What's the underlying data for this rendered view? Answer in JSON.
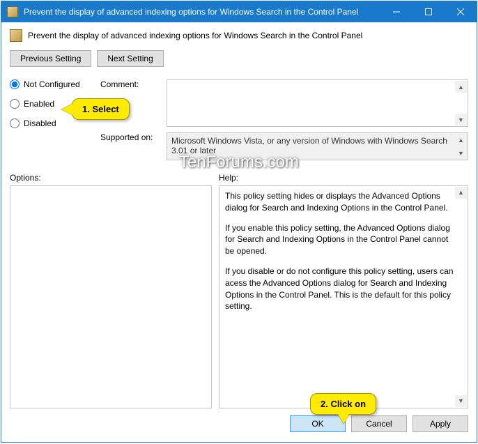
{
  "titlebar": {
    "title": "Prevent the display of advanced indexing options for Windows Search in the Control Panel"
  },
  "header": {
    "policy_title": "Prevent the display of advanced indexing options for Windows Search in the Control Panel"
  },
  "nav": {
    "previous": "Previous Setting",
    "next": "Next Setting"
  },
  "radios": {
    "not_configured": "Not Configured",
    "enabled": "Enabled",
    "disabled": "Disabled"
  },
  "fields": {
    "comment_label": "Comment:",
    "comment_value": "",
    "supported_label": "Supported on:",
    "supported_value": "Microsoft Windows Vista, or any version of Windows with Windows Search 3.01 or later"
  },
  "options": {
    "label": "Options:"
  },
  "help": {
    "label": "Help:",
    "p1": "This policy setting hides or displays the Advanced Options dialog for Search and Indexing Options in the Control Panel.",
    "p2": "If you enable this policy setting, the Advanced Options dialog for Search and Indexing Options in the Control Panel cannot be opened.",
    "p3": "If you disable or do not configure this policy setting, users can acess the Advanced Options dialog for Search and Indexing Options in the Control Panel. This is the default for this policy setting."
  },
  "footer": {
    "ok": "OK",
    "cancel": "Cancel",
    "apply": "Apply"
  },
  "annotations": {
    "select": "1. Select",
    "click": "2. Click on"
  },
  "watermark": "TenForums.com"
}
